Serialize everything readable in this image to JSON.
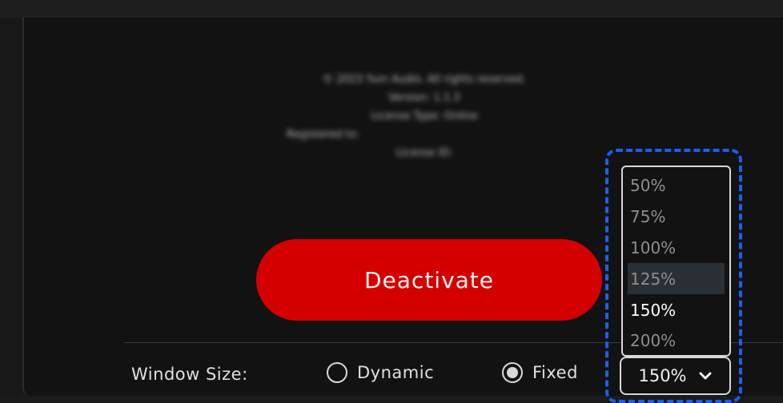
{
  "about": {
    "lines": [
      "© 2023 Yum Audio. All rights reserved.",
      "Version: 1.1.3",
      "License Type: Online",
      "Registered to:",
      "License ID:"
    ]
  },
  "deactivate_label": "Deactivate",
  "window_size": {
    "label": "Window Size:",
    "options": [
      {
        "label": "Dynamic",
        "checked": false
      },
      {
        "label": "Fixed",
        "checked": true
      }
    ]
  },
  "scale": {
    "selected": "150%",
    "options": [
      "50%",
      "75%",
      "100%",
      "125%",
      "150%",
      "200%"
    ],
    "hovered": "125%"
  },
  "colors": {
    "accent_red": "#d40000",
    "highlight_blue": "#1e5cf2",
    "panel_bg": "#121212"
  },
  "icons": {
    "select_chevron": "chevron-down-icon"
  }
}
